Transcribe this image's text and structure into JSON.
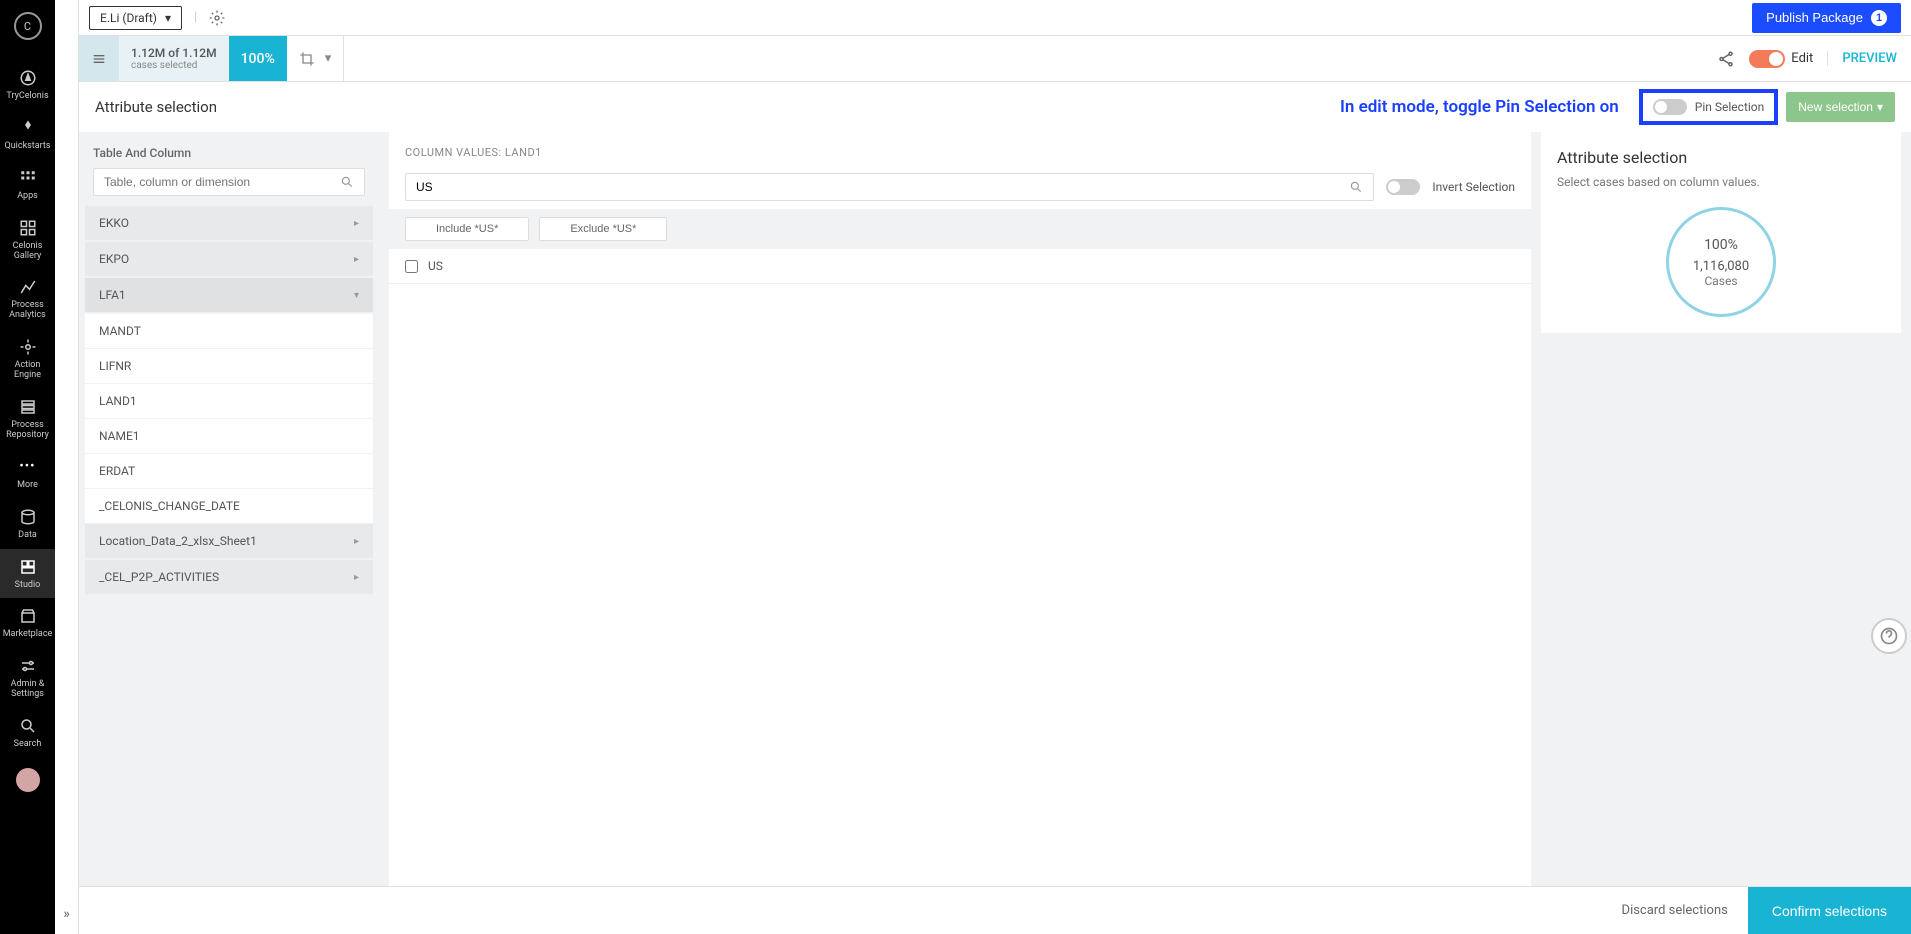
{
  "sidebar": {
    "items": [
      {
        "label": "TryCelonis"
      },
      {
        "label": "Quickstarts"
      },
      {
        "label": "Apps"
      },
      {
        "label": "Celonis Gallery"
      },
      {
        "label": "Process Analytics"
      },
      {
        "label": "Action Engine"
      },
      {
        "label": "Process Repository"
      },
      {
        "label": "More"
      },
      {
        "label": "Data"
      },
      {
        "label": "Studio"
      },
      {
        "label": "Marketplace"
      },
      {
        "label": "Admin & Settings"
      },
      {
        "label": "Search"
      }
    ]
  },
  "header": {
    "draft_label": "E.Li (Draft)",
    "publish_label": "Publish Package",
    "publish_badge": "1"
  },
  "toolbar": {
    "cases_count": "1.12M of 1.12M",
    "cases_sub": "cases selected",
    "pct": "100%",
    "edit_label": "Edit",
    "preview_label": "PREVIEW"
  },
  "actionbar": {
    "title": "Attribute selection",
    "annotation": "In edit mode, toggle Pin Selection on",
    "pin_label": "Pin Selection",
    "new_selection_label": "New selection"
  },
  "left_panel": {
    "header": "Table And Column",
    "search_placeholder": "Table, column or dimension",
    "tables": [
      {
        "name": "EKKO",
        "expanded": false
      },
      {
        "name": "EKPO",
        "expanded": false
      },
      {
        "name": "LFA1",
        "expanded": true,
        "columns": [
          "MANDT",
          "LIFNR",
          "LAND1",
          "NAME1",
          "ERDAT",
          "_CELONIS_CHANGE_DATE"
        ]
      },
      {
        "name": "Location_Data_2_xlsx_Sheet1",
        "expanded": false
      },
      {
        "name": "_CEL_P2P_ACTIVITIES",
        "expanded": false
      }
    ]
  },
  "mid_panel": {
    "header": "COLUMN VALUES: LAND1",
    "search_value": "US",
    "invert_label": "Invert Selection",
    "include_label": "Include *US*",
    "exclude_label": "Exclude *US*",
    "values": [
      {
        "label": "US",
        "checked": false
      }
    ]
  },
  "right_panel": {
    "title": "Attribute selection",
    "desc": "Select cases based on column values.",
    "pct": "100%",
    "count": "1,116,080",
    "cases": "Cases"
  },
  "bottom": {
    "discard": "Discard selections",
    "confirm": "Confirm selections"
  }
}
